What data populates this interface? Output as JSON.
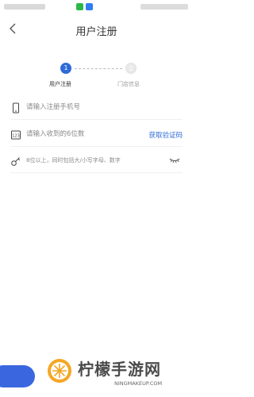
{
  "nav": {
    "title": "用户注册"
  },
  "stepper": {
    "steps": [
      {
        "number": "1",
        "label": "用户注册"
      },
      {
        "number": "2",
        "label": "门店信息"
      }
    ]
  },
  "form": {
    "phone": {
      "placeholder": "请输入注册手机号",
      "icon": "phone-icon"
    },
    "code": {
      "placeholder": "请输入收到的6位数",
      "icon": "sms-code-icon",
      "action_label": "获取验证码"
    },
    "password": {
      "placeholder": "8位以上，同时包括大/小写字母、数字",
      "icon": "key-icon"
    }
  },
  "watermark": {
    "title": "柠檬手游网",
    "url": "NINGMAKEUP.COM"
  },
  "colors": {
    "accent": "#2e6bd8",
    "button": "#3a67e0"
  }
}
